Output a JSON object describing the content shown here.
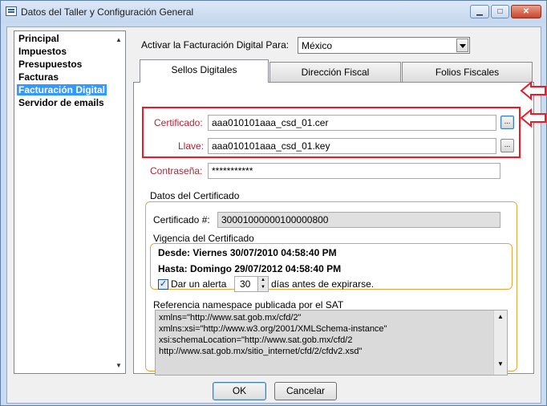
{
  "window": {
    "title": "Datos del Taller y Configuración General",
    "minimize_glyph": "▁",
    "maximize_glyph": "□",
    "close_glyph": "✕"
  },
  "sidebar": {
    "items": [
      {
        "label": "Principal"
      },
      {
        "label": "Impuestos"
      },
      {
        "label": "Presupuestos"
      },
      {
        "label": "Facturas"
      },
      {
        "label": "Facturación Digital"
      },
      {
        "label": "Servidor de emails"
      }
    ],
    "selected_index": 4,
    "scroll_up_glyph": "▲",
    "scroll_down_glyph": "▼"
  },
  "activation": {
    "label": "Activar la Facturación Digital Para:",
    "value": "México"
  },
  "tabs": [
    {
      "label": "Sellos Digitales",
      "active": true
    },
    {
      "label": "Dirección Fiscal",
      "active": false
    },
    {
      "label": "Folios Fiscales",
      "active": false
    }
  ],
  "seals": {
    "certificate_label": "Certificado:",
    "certificate_value": "aaa010101aaa_csd_01.cer",
    "key_label": "Llave:",
    "key_value": "aaa010101aaa_csd_01.key",
    "browse_label": "...",
    "password_label": "Contraseña:",
    "password_value": "***********"
  },
  "certificate_data": {
    "group_label": "Datos del Certificado",
    "number_label": "Certificado #:",
    "number_value": "30001000000100000800",
    "validity_label": "Vigencia del Certificado",
    "from": "Desde: Viernes 30/07/2010 04:58:40 PM",
    "to": "Hasta: Domingo 29/07/2012 04:58:40 PM",
    "alert_checked": true,
    "alert_label": "Dar un alerta",
    "alert_days": "30",
    "alert_suffix": "días antes de expirarse."
  },
  "namespace": {
    "label": "Referencia namespace publicada por el SAT",
    "lines": [
      "xmlns=\"http://www.sat.gob.mx/cfd/2\"",
      "xmlns:xsi=\"http://www.w3.org/2001/XMLSchema-instance\"",
      "xsi:schemaLocation=\"http://www.sat.gob.mx/cfd/2",
      "http://www.sat.gob.mx/sitio_internet/cfd/2/cfdv2.xsd\""
    ],
    "scroll_up_glyph": "▲",
    "scroll_down_glyph": "▼"
  },
  "buttons": {
    "ok": "OK",
    "cancel": "Cancelar"
  },
  "colors": {
    "highlight": "#e51d2b",
    "label_red": "#b0243a",
    "selection": "#3399ff",
    "group_border": "#e0a640"
  }
}
